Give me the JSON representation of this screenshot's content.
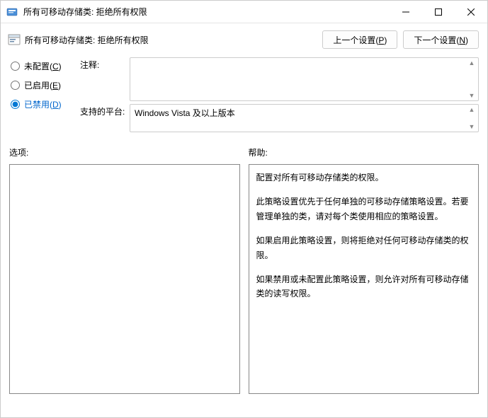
{
  "window": {
    "title": "所有可移动存储类: 拒绝所有权限"
  },
  "header": {
    "policy_title": "所有可移动存储类: 拒绝所有权限",
    "prev_button_prefix": "上一个设置(",
    "prev_button_key": "P",
    "prev_button_suffix": ")",
    "next_button_prefix": "下一个设置(",
    "next_button_key": "N",
    "next_button_suffix": ")"
  },
  "radios": {
    "not_configured_prefix": "未配置(",
    "not_configured_key": "C",
    "not_configured_suffix": ")",
    "enabled_prefix": "已启用(",
    "enabled_key": "E",
    "enabled_suffix": ")",
    "disabled_prefix": "已禁用(",
    "disabled_key": "D",
    "disabled_suffix": ")",
    "selected": "disabled"
  },
  "fields": {
    "comment_label": "注释:",
    "platform_label": "支持的平台:",
    "platform_value": "Windows Vista 及以上版本"
  },
  "lower": {
    "options_label": "选项:",
    "help_label": "帮助:",
    "help_p1": "配置对所有可移动存储类的权限。",
    "help_p2": "此策略设置优先于任何单独的可移动存储策略设置。若要管理单独的类，请对每个类使用相应的策略设置。",
    "help_p3": "如果启用此策略设置，则将拒绝对任何可移动存储类的权限。",
    "help_p4": "如果禁用或未配置此策略设置，则允许对所有可移动存储类的读写权限。"
  }
}
